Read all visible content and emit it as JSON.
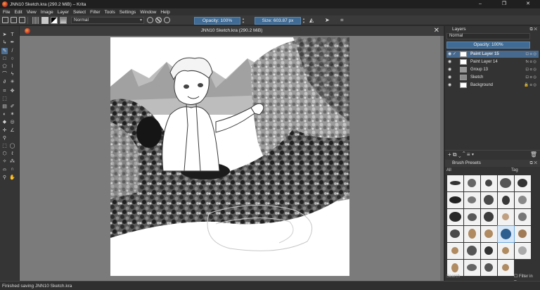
{
  "window": {
    "title": "JNN10 Sketch.kra (290.2 MiB)  – Krita",
    "controls": [
      "–",
      "❐",
      "✕"
    ]
  },
  "menu": [
    "File",
    "Edit",
    "View",
    "Image",
    "Layer",
    "Select",
    "Filter",
    "Tools",
    "Settings",
    "Window",
    "Help"
  ],
  "toolbar": {
    "blend_mode": "Normal",
    "opacity": "Opacity: 100%",
    "size": "Size: 603.87 px"
  },
  "document": {
    "title": "JNN10 Sketch.kra (290.2 MiB)",
    "close": "✕"
  },
  "layers": {
    "header": "Layers",
    "blend_mode": "Normal",
    "opacity": "Opacity: 100%",
    "items": [
      {
        "name": "Paint Layer 15",
        "selected": true,
        "flags": "⊡ α ◎"
      },
      {
        "name": "Paint Layer 14",
        "selected": false,
        "flags": "fx α ◎"
      },
      {
        "name": "Group 13",
        "selected": false,
        "flags": "⊡ α ◎"
      },
      {
        "name": "Sketch",
        "selected": false,
        "flags": "⊡ α ◎"
      },
      {
        "name": "Background",
        "selected": false,
        "flags": "🔒 α ◎"
      }
    ],
    "actions": "+ ⧉ ⌄ ⌃ ≡ ▾"
  },
  "brush_presets": {
    "header": "Brush Presets",
    "filter": "All",
    "tag": "Tag",
    "search_placeholder": "Search",
    "filter_in_tag": "Filter in Tag"
  },
  "status": {
    "message": "Finished saving JNN10 Sketch.kra"
  }
}
